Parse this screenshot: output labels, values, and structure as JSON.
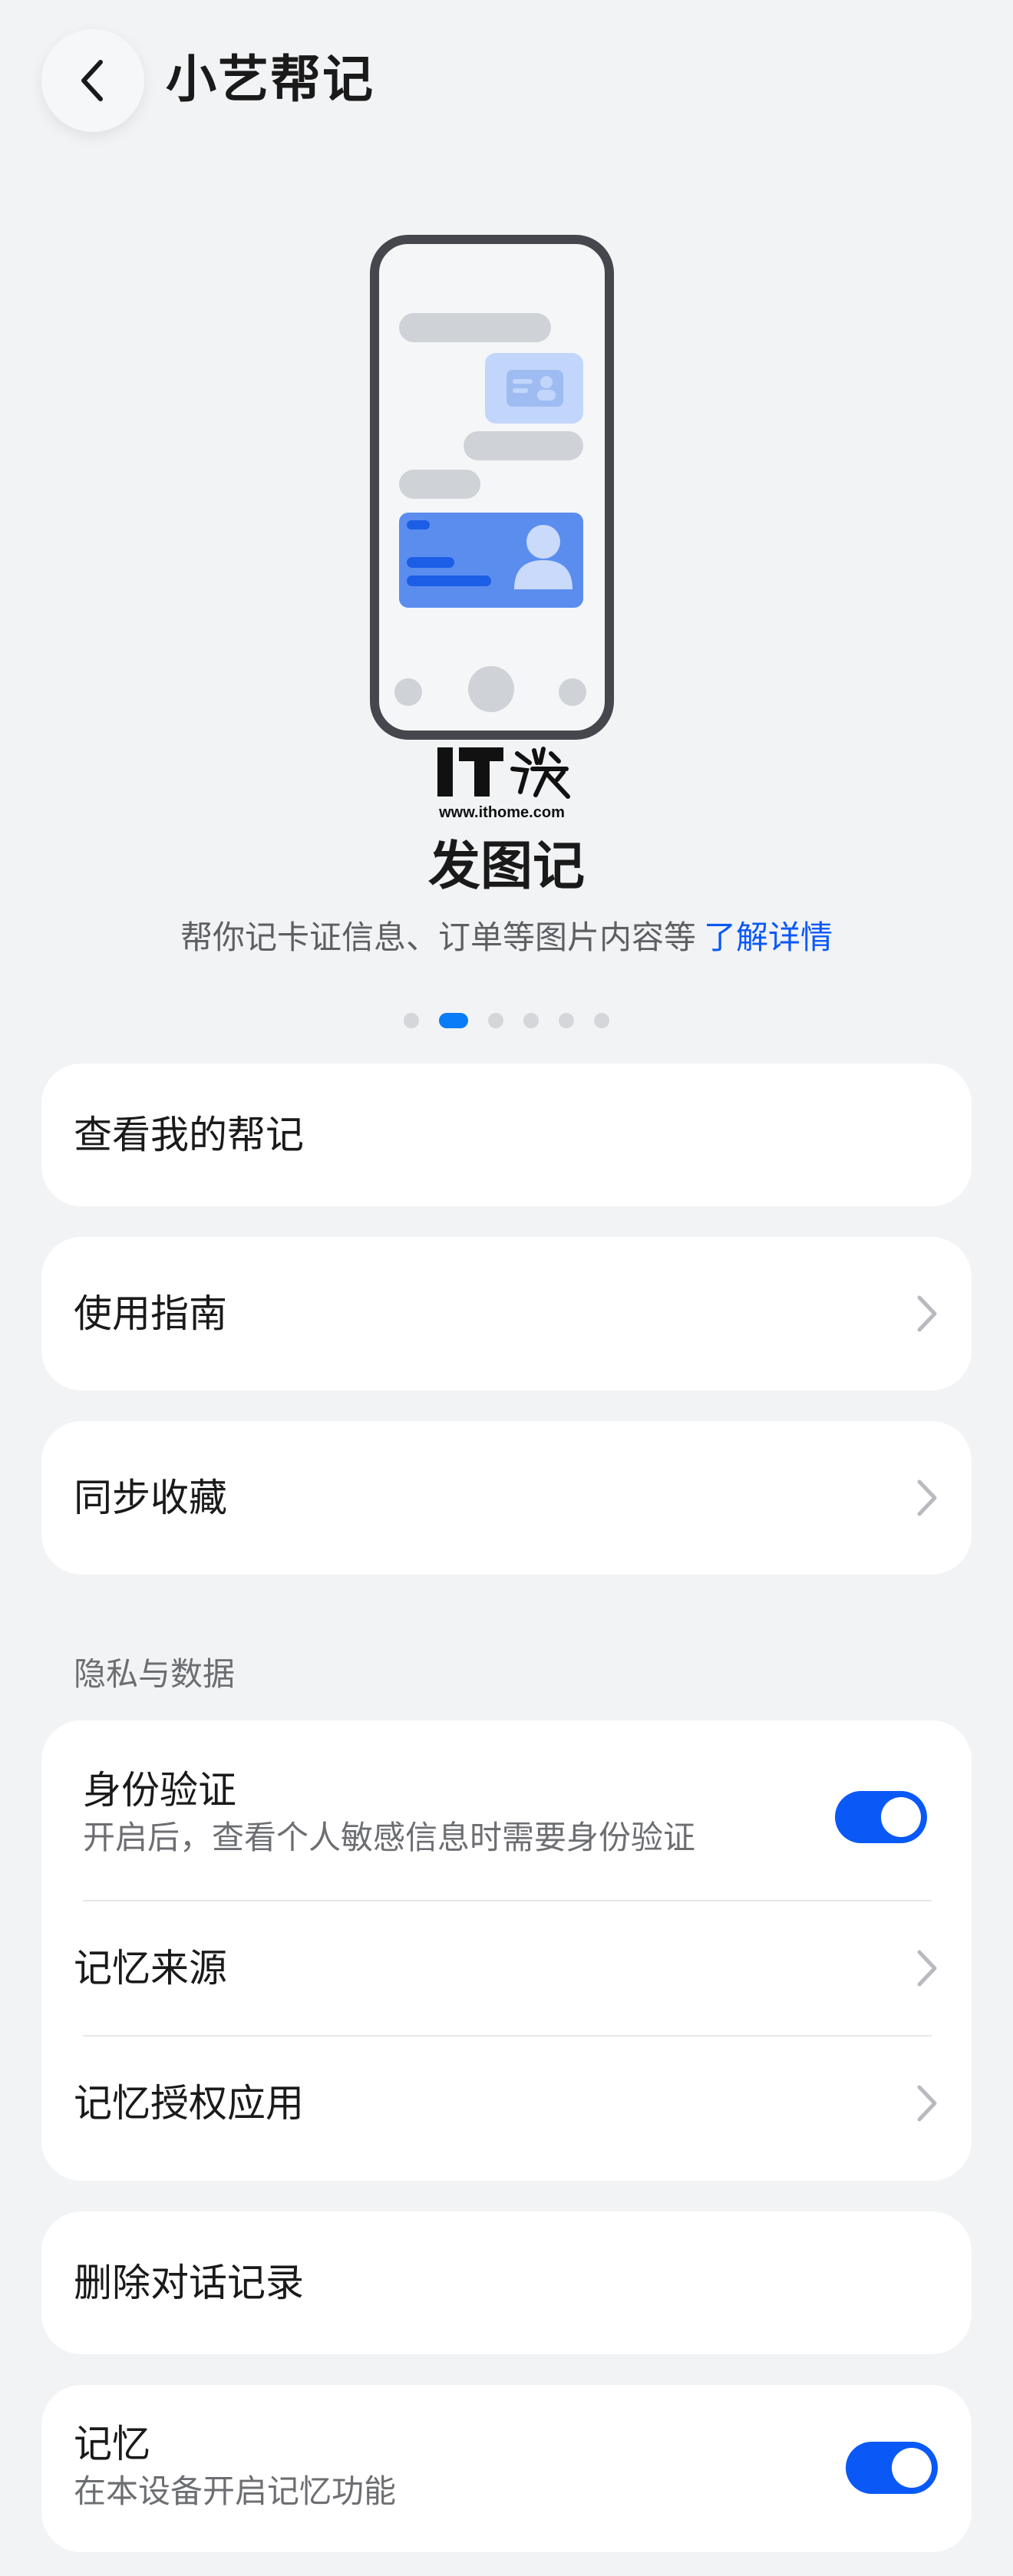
{
  "header": {
    "title": "小艺帮记",
    "back_icon": "chevron-left-icon"
  },
  "watermark": {
    "logo_text": "IT之家",
    "url": "www.ithome.com"
  },
  "feature": {
    "title": "发图记",
    "description": "帮你记卡证信息、订单等图片内容等",
    "learn_more": "了解详情",
    "page_count": 6,
    "active_page_index": 1
  },
  "menu": {
    "view_notes": "查看我的帮记",
    "guide": "使用指南",
    "sync_favorites": "同步收藏"
  },
  "privacy": {
    "section_title": "隐私与数据",
    "identity_verification": {
      "label": "身份验证",
      "description": "开启后，查看个人敏感信息时需要身份验证",
      "enabled": true
    },
    "memory_source": "记忆来源",
    "memory_authorized_apps": "记忆授权应用"
  },
  "delete_history": "删除对话记录",
  "memory": {
    "label": "记忆",
    "description": "在本设备开启记忆功能",
    "enabled": true
  },
  "colors": {
    "accent": "#0a59f7",
    "page_indicator_active": "#0a7cf7",
    "background": "#f1f3f5",
    "card": "#ffffff"
  }
}
